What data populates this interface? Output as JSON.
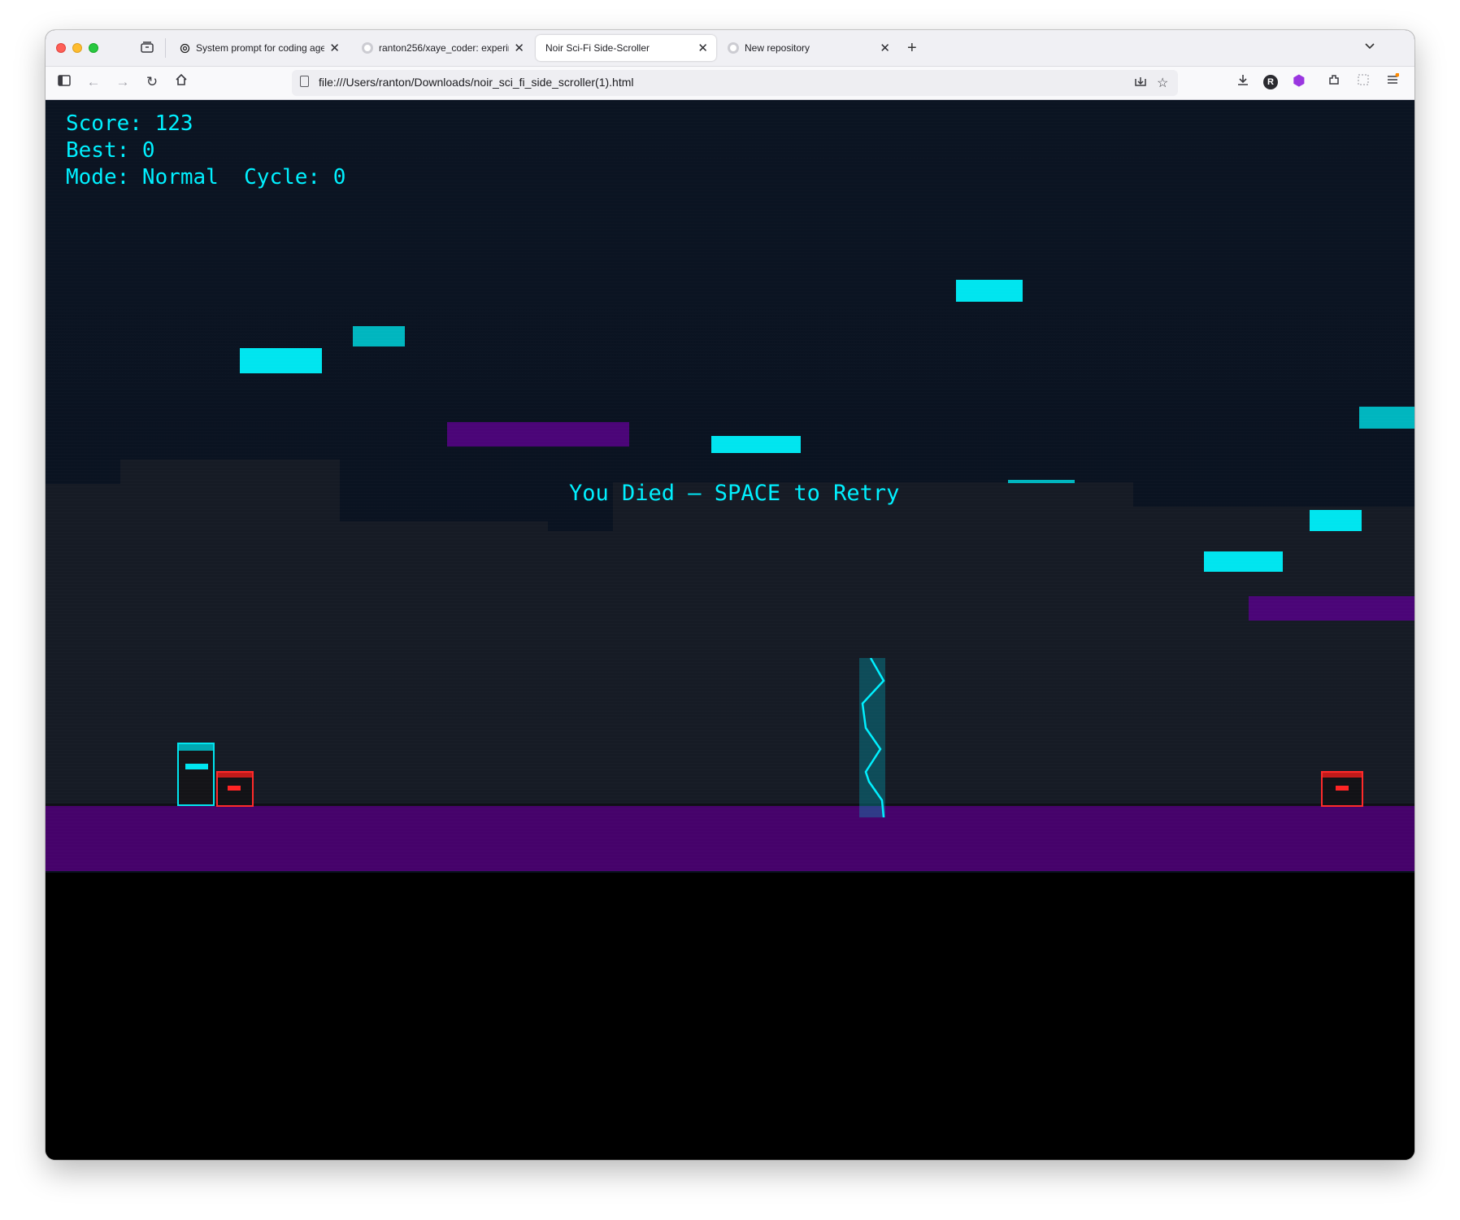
{
  "browser": {
    "tabs": [
      {
        "title": "System prompt for coding agent",
        "icon": "openai-icon"
      },
      {
        "title": "ranton256/xaye_coder: experim",
        "icon": "github-icon"
      },
      {
        "title": "Noir Sci-Fi Side-Scroller",
        "icon": "none"
      },
      {
        "title": "New repository",
        "icon": "github-icon"
      }
    ],
    "active_tab": 2,
    "url": "file:///Users/ranton/Downloads/noir_sci_fi_side_scroller(1).html",
    "profile_initial": "R"
  },
  "game": {
    "hud": {
      "score_label": "Score: 123",
      "best_label": "Best: 0",
      "mode_cycle_label": "Mode: Normal  Cycle: 0"
    },
    "score": 123,
    "best": 0,
    "mode": "Normal",
    "cycle": 0,
    "death_message": "You Died — SPACE to Retry",
    "colors": {
      "sky": "#0b1422",
      "buildings": "#161b25",
      "accent_cyan": "#00e5ef",
      "platform_purple": "#4b0578",
      "ground": "#46026b",
      "enemy_red": "#ff2a2a"
    }
  }
}
